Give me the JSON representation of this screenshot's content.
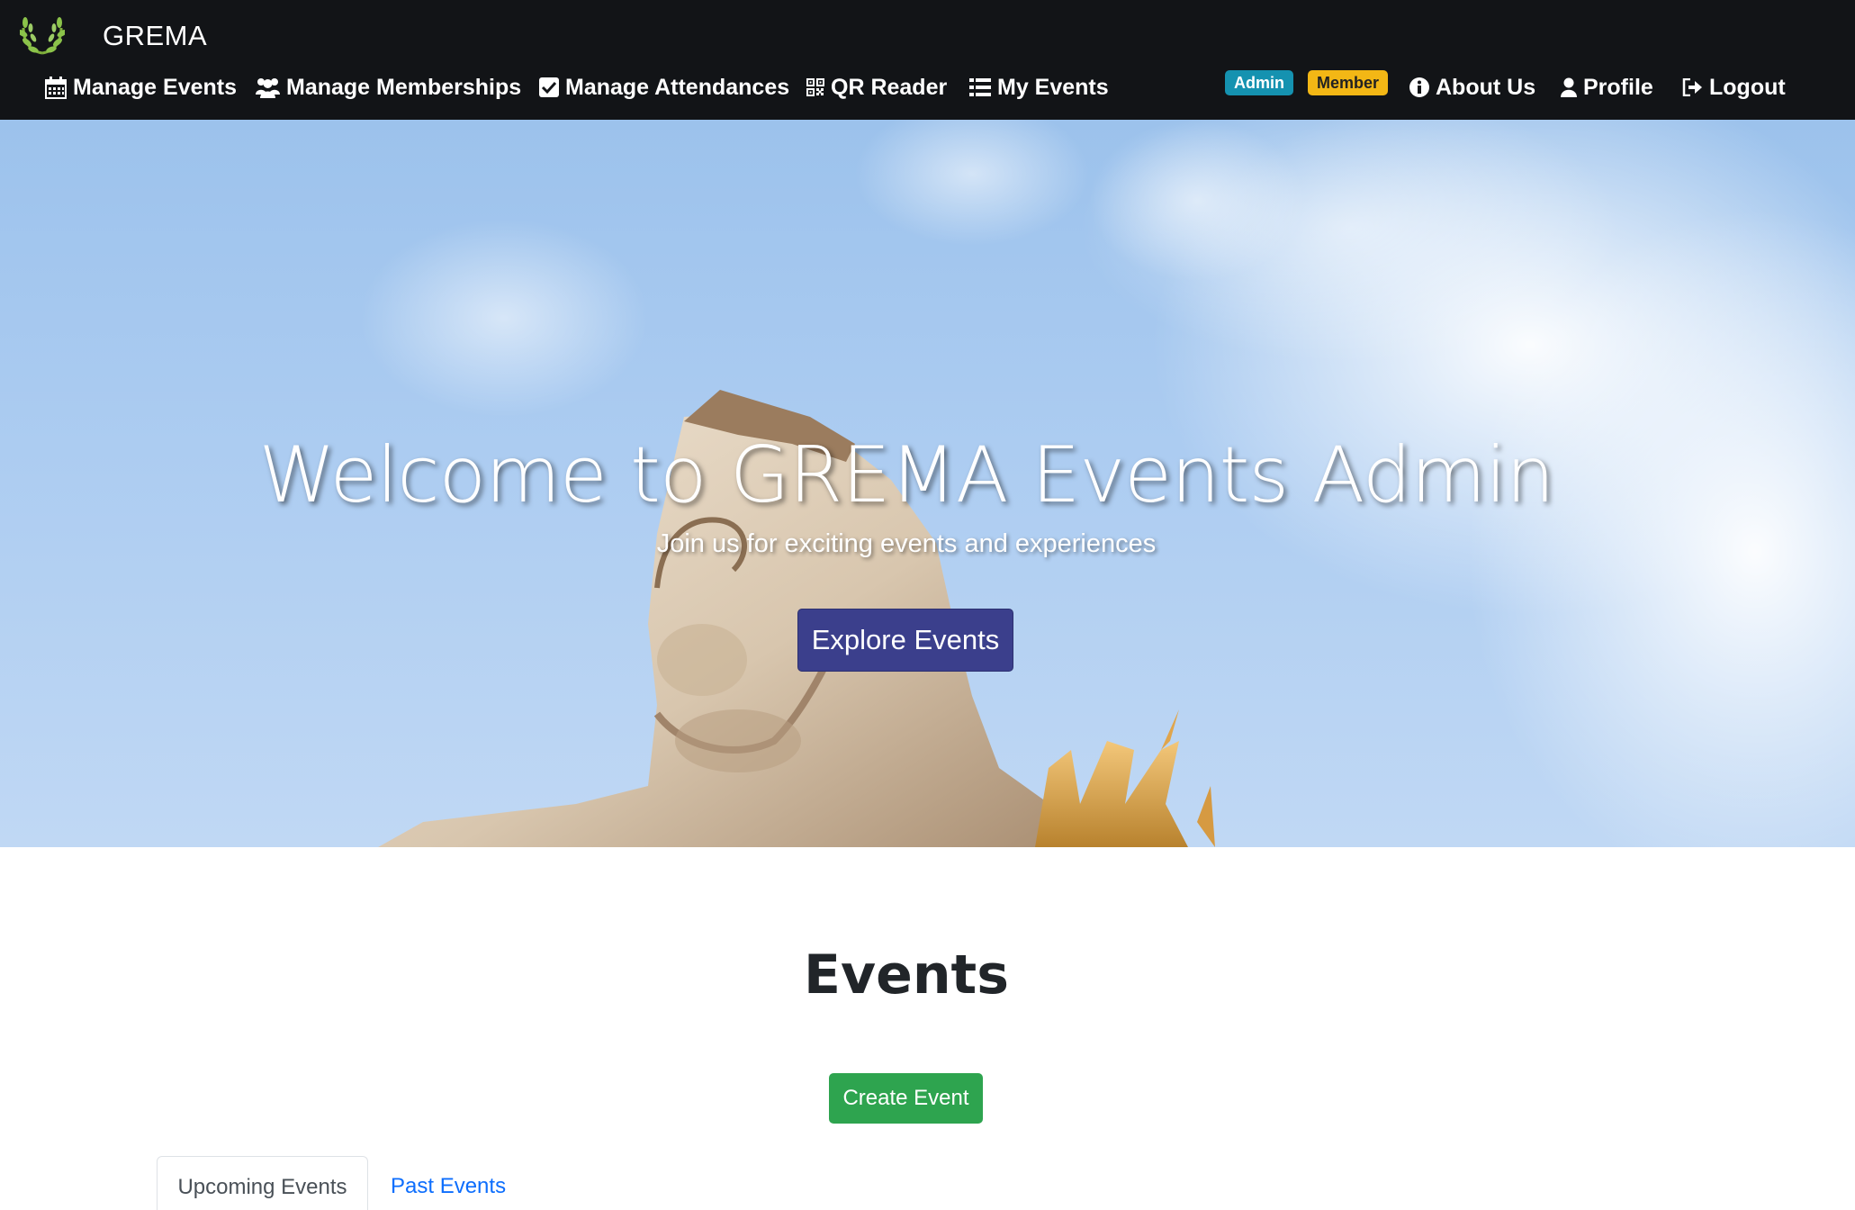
{
  "brand": {
    "name": "GREMA",
    "logo_icon": "laurel-wreath-icon"
  },
  "nav": {
    "left_items": [
      {
        "label": "Manage Events",
        "icon": "calendar-icon"
      },
      {
        "label": "Manage Memberships",
        "icon": "users-icon"
      },
      {
        "label": "Manage Attendances",
        "icon": "check-square-icon"
      },
      {
        "label": "QR Reader",
        "icon": "qrcode-icon"
      },
      {
        "label": "My Events",
        "icon": "list-icon"
      }
    ],
    "badges": {
      "admin": "Admin",
      "member": "Member"
    },
    "right_items": [
      {
        "label": "About Us",
        "icon": "info-circle-icon"
      },
      {
        "label": "Profile",
        "icon": "user-icon"
      },
      {
        "label": "Logout",
        "icon": "sign-out-icon"
      }
    ]
  },
  "hero": {
    "title": "Welcome to GREMA Events Admin",
    "subtitle": "Join us for exciting events and experiences",
    "button": "Explore Events"
  },
  "events": {
    "heading": "Events",
    "create_button": "Create Event",
    "tabs": {
      "upcoming": "Upcoming Events",
      "past": "Past Events"
    }
  },
  "colors": {
    "navbar_bg": "#121417",
    "badge_admin": "#1592b0",
    "badge_member": "#f3b715",
    "explore_button": "#3b3f8c",
    "create_button": "#2ea44f",
    "link": "#0d6efd"
  }
}
